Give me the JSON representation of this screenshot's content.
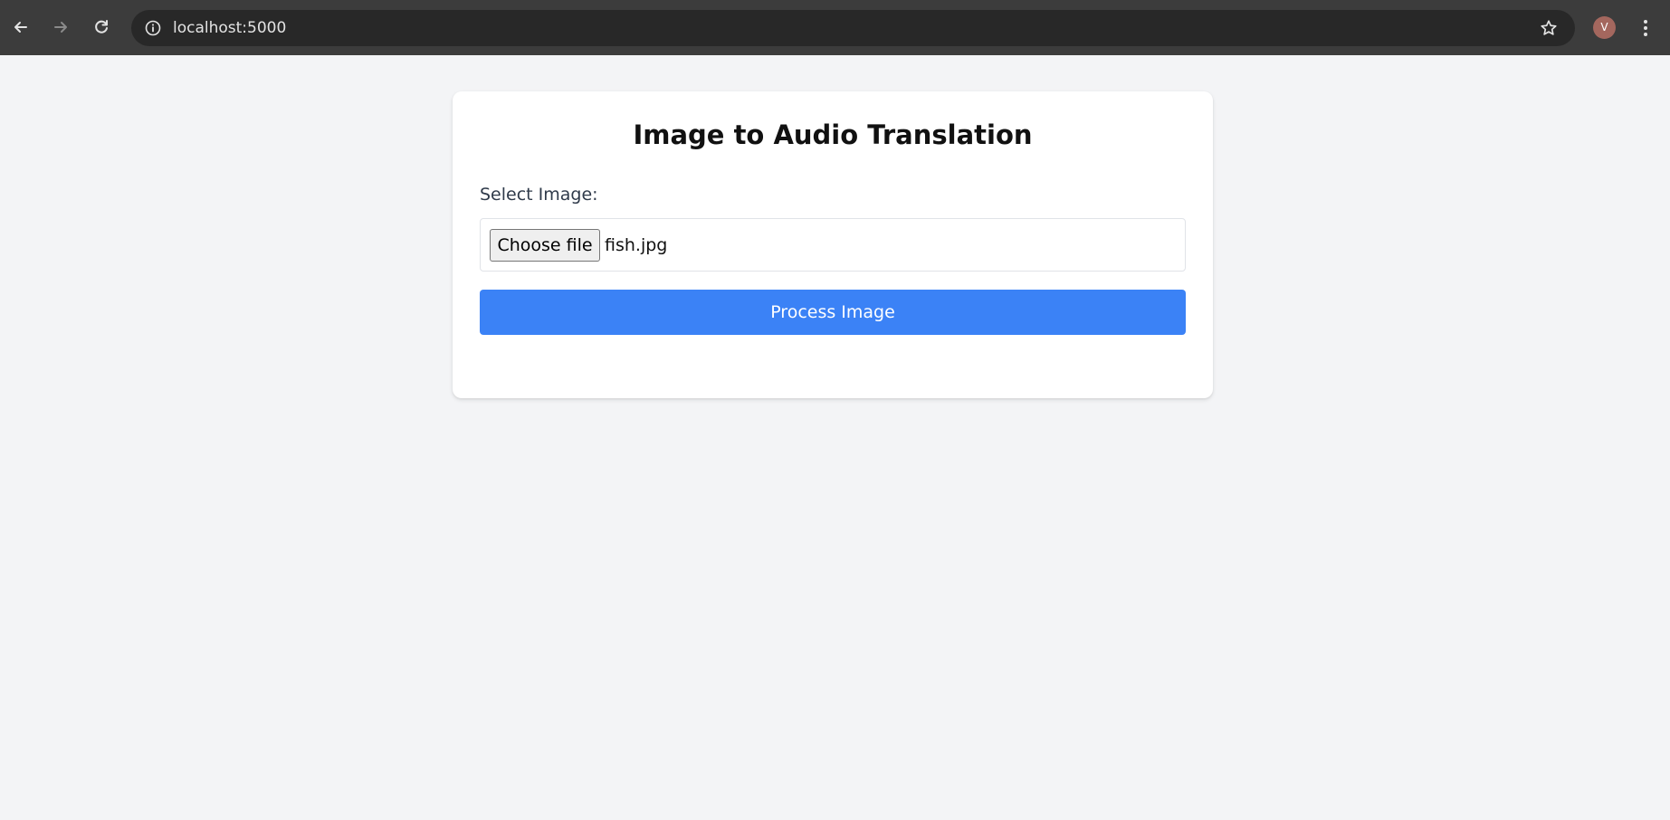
{
  "browser": {
    "url": "localhost:5000",
    "avatar_initial": "V"
  },
  "icons": {
    "back": "back-arrow-icon",
    "forward": "forward-arrow-icon",
    "reload": "reload-icon",
    "site_info": "info-icon",
    "bookmark": "star-icon",
    "menu": "vertical-dots-icon"
  },
  "colors": {
    "accent": "#3b82f6",
    "page_background": "#f3f4f6",
    "avatar": "#a4675e"
  },
  "form": {
    "title": "Image to Audio Translation",
    "image_label": "Select Image:",
    "choose_file_label": "Choose file",
    "selected_file": "fish.jpg",
    "submit_label": "Process Image"
  }
}
